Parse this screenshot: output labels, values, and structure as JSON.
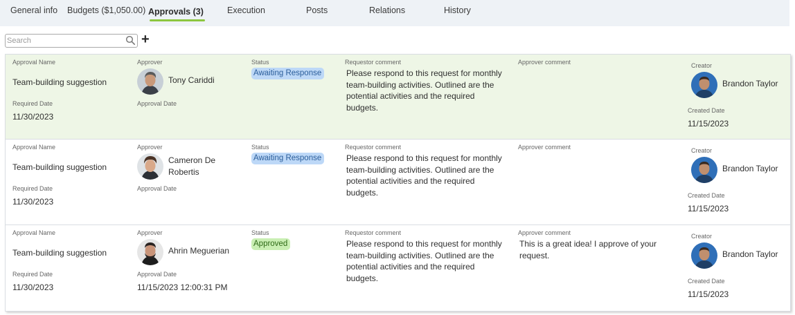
{
  "tabs": [
    {
      "label": "General info"
    },
    {
      "label": "Budgets ($1,050.00)"
    },
    {
      "label": "Approvals (3)"
    },
    {
      "label": "Execution"
    },
    {
      "label": "Posts"
    },
    {
      "label": "Relations"
    },
    {
      "label": "History"
    }
  ],
  "active_tab_index": 2,
  "search": {
    "placeholder": "Search",
    "value": ""
  },
  "add_label": "+",
  "labels": {
    "approval_name": "Approval Name",
    "approver": "Approver",
    "status": "Status",
    "requestor_comment": "Requestor comment",
    "approver_comment": "Approver comment",
    "creator": "Creator",
    "required_date": "Required Date",
    "approval_date": "Approval Date",
    "created_date": "Created Date"
  },
  "approvals": [
    {
      "name": "Team-building suggestion",
      "required_date": "11/30/2023",
      "approver": "Tony Cariddi",
      "approval_date": "",
      "status": "Awaiting Response",
      "status_kind": "awaiting",
      "requestor_comment": "Please respond to this request for monthly team-building activities. Outlined are the potential activities and the required budgets.",
      "approver_comment": "",
      "creator": "Brandon Taylor",
      "created_date": "11/15/2023",
      "highlighted": true
    },
    {
      "name": "Team-building suggestion",
      "required_date": "11/30/2023",
      "approver": "Cameron De Robertis",
      "approval_date": "",
      "status": "Awaiting Response",
      "status_kind": "awaiting",
      "requestor_comment": "Please respond to this request for monthly team-building activities. Outlined are the potential activities and the required budgets.",
      "approver_comment": "",
      "creator": "Brandon Taylor",
      "created_date": "11/15/2023",
      "highlighted": false
    },
    {
      "name": "Team-building suggestion",
      "required_date": "11/30/2023",
      "approver": "Ahrin Meguerian",
      "approval_date": "11/15/2023 12:00:31 PM",
      "status": "Approved",
      "status_kind": "approved",
      "requestor_comment": "Please respond to this request for monthly team-building activities. Outlined are the potential activities and the required budgets.",
      "approver_comment": "This is a great idea! I approve of your request.",
      "creator": "Brandon Taylor",
      "created_date": "11/15/2023",
      "highlighted": false
    }
  ],
  "colors": {
    "tab_underline": "#8cc63f",
    "row_highlight": "#eef6e6",
    "awaiting_bg": "#bdd8f7",
    "approved_bg": "#c9efb3"
  }
}
